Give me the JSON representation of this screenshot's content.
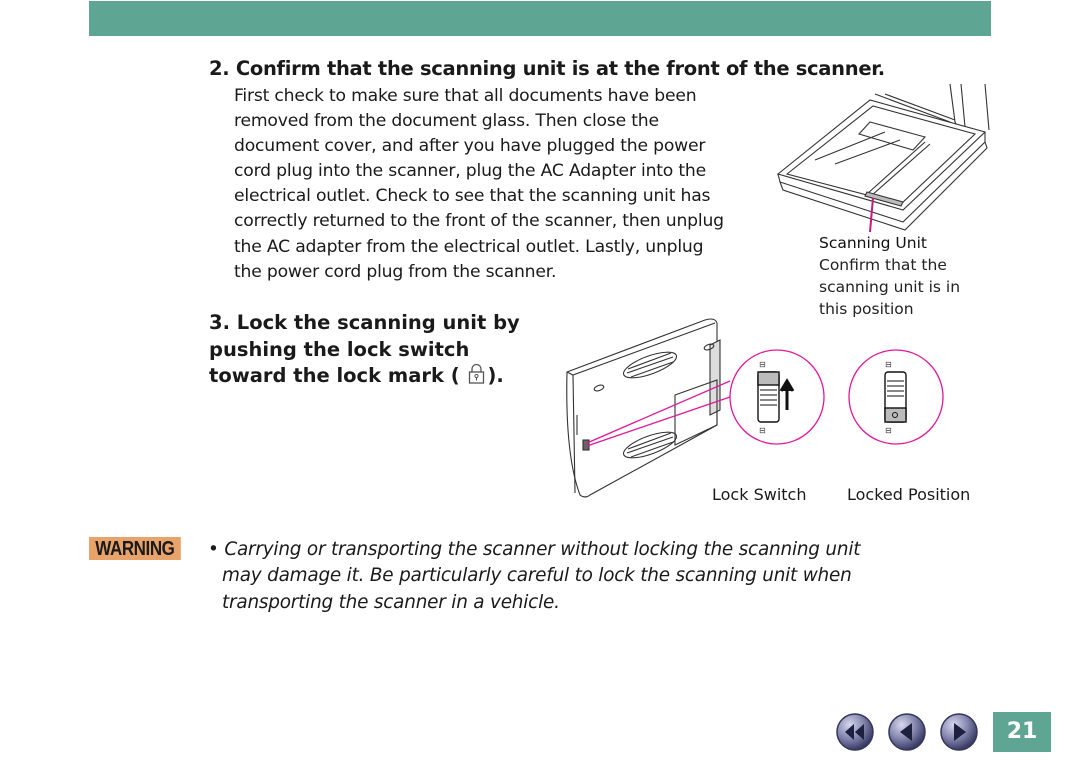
{
  "header": {
    "bar_color": "#5fa593"
  },
  "step2": {
    "title": "2. Confirm that the scanning unit is at the front of the scanner.",
    "body_lines": [
      "First check to make sure that all documents have been",
      "removed from the document glass. Then close the",
      "document cover, and after you have plugged the power",
      "cord plug into the scanner, plug the AC Adapter into the",
      "electrical outlet. Check to see that the scanning unit has",
      "correctly returned to the front of the scanner, then unplug",
      "the AC adapter from the electrical outlet. Lastly, unplug",
      "the power cord plug from the scanner."
    ],
    "figure": {
      "icon": "scanner-open-lid-illustration",
      "caption_title": "Scanning Unit",
      "caption_lines": [
        "Confirm that the",
        "scanning unit is in",
        "this position"
      ]
    }
  },
  "step3": {
    "title_lines": [
      "3. Lock the scanning unit by",
      "pushing the lock switch",
      "toward the lock mark ("
    ],
    "title_end": ").",
    "lock_mark_icon": "padlock-icon",
    "figure": {
      "icon": "scanner-back-illustration",
      "label_lock_switch": "Lock Switch",
      "label_locked_position": "Locked Position"
    }
  },
  "warning": {
    "badge": "WARNING",
    "badge_color": "#e8a36a",
    "bullet": "•",
    "lines": [
      "Carrying or transporting the scanner without locking the scanning unit",
      "may damage it. Be particularly careful to lock the scanning unit when",
      "transporting the scanner in a vehicle."
    ]
  },
  "footer": {
    "nav": [
      {
        "name": "first-page",
        "icon": "double-left-arrow-icon"
      },
      {
        "name": "previous-page",
        "icon": "left-arrow-icon"
      },
      {
        "name": "next-page",
        "icon": "right-arrow-icon"
      }
    ],
    "page_number": "21",
    "accent": "#5fa593",
    "callout_color": "#e0189a"
  }
}
